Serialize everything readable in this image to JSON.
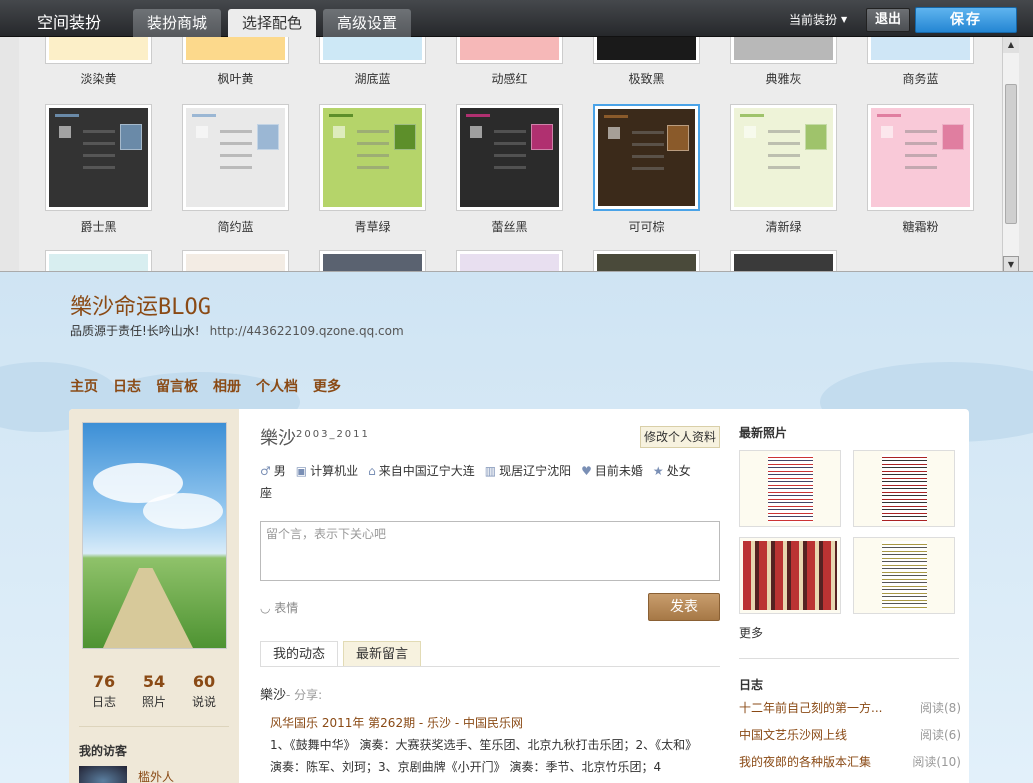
{
  "topbar": {
    "title": "空间装扮",
    "tabs": [
      "装扮商城",
      "选择配色",
      "高级设置"
    ],
    "current_theme": "当前装扮",
    "exit": "退出",
    "save": "保存"
  },
  "themes": {
    "row1": [
      "淡染黄",
      "枫叶黄",
      "湖底蓝",
      "动感红",
      "极致黑",
      "典雅灰",
      "商务蓝"
    ],
    "row2": [
      "爵士黑",
      "简约蓝",
      "青草绿",
      "蕾丝黑",
      "可可棕",
      "清新绿",
      "糖霜粉"
    ],
    "selected": "可可棕",
    "colors1": [
      "#fcefc8",
      "#fcd98c",
      "#cde8f6",
      "#f6b8b8",
      "#1a1a1a",
      "#b8b8b8",
      "#cfe6f6"
    ],
    "colors2": [
      "#333333",
      "#e9e9e9",
      "#b5d46a",
      "#2b2b2b",
      "#3b2a1a",
      "#eef3d8",
      "#f9c9d8"
    ],
    "accent2": [
      "#6a8aa8",
      "#9bb7d4",
      "#5d8f2a",
      "#b03070",
      "#8a5a2a",
      "#9fc36b",
      "#e07ea0"
    ]
  },
  "blog": {
    "title": "樂沙命运BLOG",
    "subtitle": "品质源于责任!长吟山水!",
    "url": "http://443622109.qzone.qq.com",
    "nav": [
      "主页",
      "日志",
      "留言板",
      "相册",
      "个人档",
      "更多"
    ]
  },
  "profile": {
    "name": "樂沙",
    "sup": "2003_2011",
    "edit": "修改个人资料",
    "gender": "男",
    "job": "计算机业",
    "hometown": "来自中国辽宁大连",
    "location": "现居辽宁沈阳",
    "marital": "目前未婚",
    "zodiac": "处女座",
    "msg_placeholder": "留个言，表示下关心吧",
    "expr": "表情",
    "send": "发表",
    "stats": [
      {
        "n": "76",
        "l": "日志"
      },
      {
        "n": "54",
        "l": "照片"
      },
      {
        "n": "60",
        "l": "说说"
      }
    ],
    "visitors_title": "我的访客",
    "visitor": "槛外人"
  },
  "feed": {
    "tab1": "我的动态",
    "tab2": "最新留言",
    "user": "樂沙",
    "share": "- 分享:",
    "title": "风华国乐 2011年 第262期 - 乐沙 - 中国民乐网",
    "body": "1、《鼓舞中华》 演奏：大赛获奖选手、笙乐团、北京九秋打击乐团；2、《太和》 演奏：陈军、刘珂；3、京剧曲牌《小开门》 演奏：季节、北京竹乐团；4"
  },
  "right": {
    "photos_title": "最新照片",
    "more": "更多",
    "logs_title": "日志",
    "logs": [
      {
        "t": "十二年前自己刻的第一方...",
        "c": "阅读(8)"
      },
      {
        "t": "中国文艺乐沙网上线",
        "c": "阅读(6)"
      },
      {
        "t": "我的夜郎的各种版本汇集",
        "c": "阅读(10)"
      }
    ]
  }
}
